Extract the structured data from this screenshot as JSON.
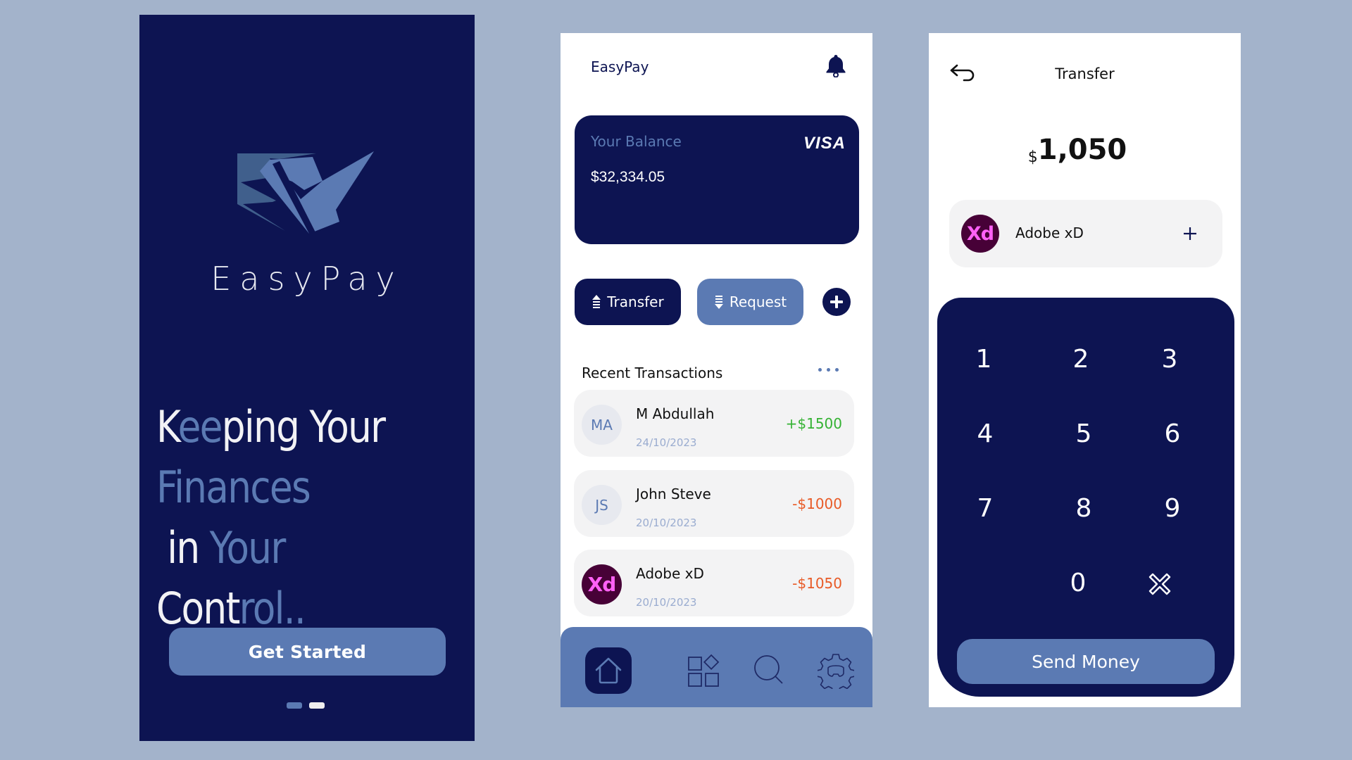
{
  "colors": {
    "background": "#a3b3cb",
    "navy": "#0d1452",
    "accent_blue": "#5b7ab3",
    "positive": "#34b233",
    "negative": "#e85a26",
    "xd_bg": "#470137",
    "xd_fg": "#ff61f6"
  },
  "splash": {
    "brand_name": "EasyPay",
    "logo_icon": "easypay-logo-icon",
    "tagline": {
      "line1": [
        {
          "text": "K",
          "highlight": false
        },
        {
          "text": "ee",
          "highlight": true
        },
        {
          "text": "ping Your",
          "highlight": false
        }
      ],
      "line2": [
        {
          "text": "Finances",
          "highlight": true
        },
        {
          "text": " in ",
          "highlight": false
        },
        {
          "text": "Your",
          "highlight": true
        }
      ],
      "line3": [
        {
          "text": "Cont",
          "highlight": false
        },
        {
          "text": "rol..",
          "highlight": true
        }
      ]
    },
    "get_started_label": "Get Started",
    "pagination": {
      "total": 2,
      "active_index": 1
    }
  },
  "home": {
    "app_title": "EasyPay",
    "bell_icon": "bell-icon",
    "balance_card": {
      "label": "Your Balance",
      "value": "$32,334.05",
      "card_brand": "VISA"
    },
    "actions": {
      "transfer_label": "Transfer",
      "request_label": "Request",
      "add_icon": "plus-icon"
    },
    "recent_transactions": {
      "title": "Recent Transactions",
      "more_icon": "more-dots-icon",
      "items": [
        {
          "initials": "MA",
          "name": "M Abdullah",
          "date": "24/10/2023",
          "amount": "+$1500",
          "type": "credit"
        },
        {
          "initials": "JS",
          "name": "John Steve",
          "date": "20/10/2023",
          "amount": "-$1000",
          "type": "debit"
        },
        {
          "initials": "Xd",
          "name": "Adobe xD",
          "date": "20/10/2023",
          "amount": "-$1050",
          "type": "debit",
          "brand_logo": true
        }
      ]
    },
    "bottom_nav": [
      {
        "icon": "home-icon",
        "active": true
      },
      {
        "icon": "apps-grid-icon",
        "active": false
      },
      {
        "icon": "search-icon",
        "active": false
      },
      {
        "icon": "settings-gear-icon",
        "active": false
      }
    ]
  },
  "transfer": {
    "title": "Transfer",
    "back_icon": "back-arrow-icon",
    "amount": {
      "currency": "$",
      "value": "1,050"
    },
    "recipient": {
      "initials": "Xd",
      "name": "Adobe xD",
      "add_icon": "plus-icon"
    },
    "keypad": {
      "keys": [
        "1",
        "2",
        "3",
        "4",
        "5",
        "6",
        "7",
        "8",
        "9",
        "",
        "0",
        "clear"
      ],
      "clear_icon": "clear-x-icon"
    },
    "send_label": "Send Money"
  }
}
